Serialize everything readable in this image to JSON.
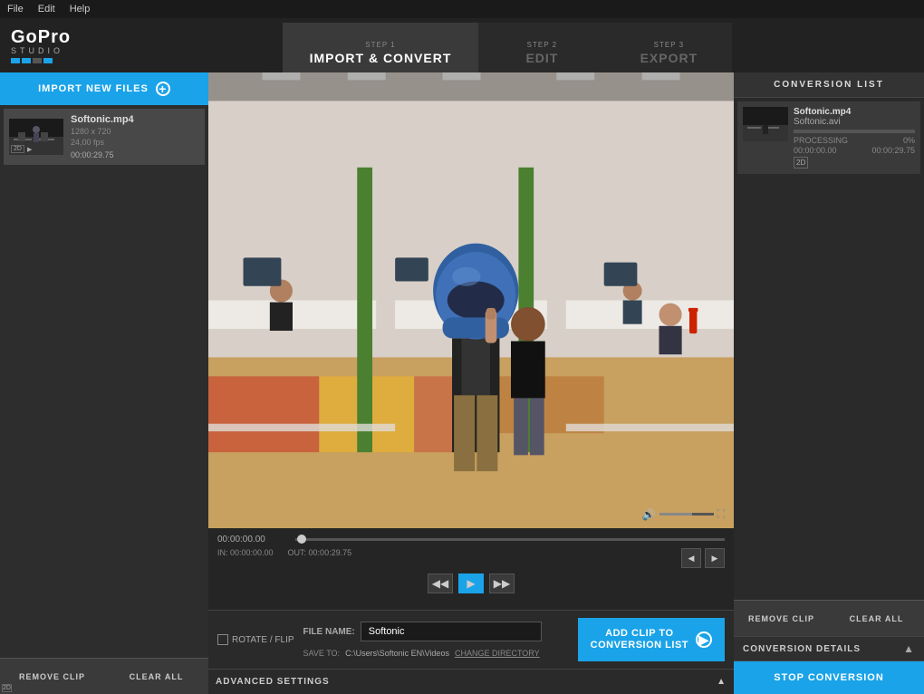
{
  "menu": {
    "items": [
      "File",
      "Edit",
      "Help"
    ]
  },
  "logo": {
    "name": "GoPro",
    "studio": "STUDIO",
    "dots": [
      "#1aa3e8",
      "#1aa3e8",
      "#555",
      "#1aa3e8"
    ]
  },
  "steps": [
    {
      "id": "step1",
      "label": "STEP 1",
      "name": "IMPORT & CONVERT",
      "active": true
    },
    {
      "id": "step2",
      "label": "STEP 2",
      "name": "EDIT",
      "active": false
    },
    {
      "id": "step3",
      "label": "STEP 3",
      "name": "EXPORT",
      "active": false
    }
  ],
  "import_button": {
    "label": "IMPORT NEW FILES"
  },
  "file_list": [
    {
      "name": "Softonic.mp4",
      "resolution": "1280 x 720",
      "fps": "24,00 fps",
      "duration": "00:00:29.75",
      "badge": "2D",
      "selected": true
    }
  ],
  "left_bottom_buttons": {
    "remove": "REMOVE CLIP",
    "clear": "CLEAR ALL"
  },
  "video_controls": {
    "timestamp": "00:00:00.00",
    "in_point": "IN: 00:00:00.00",
    "out_point": "OUT: 00:00:29.75"
  },
  "bottom_controls": {
    "rotate_label": "ROTATE / FLIP",
    "filename_label": "FILE NAME:",
    "filename_value": "Softonic",
    "saveto_label": "SAVE TO:",
    "saveto_path": "C:\\Users\\Softonic EN\\Videos",
    "change_dir_label": "CHANGE DIRECTORY",
    "add_button": "ADD CLIP TO\nCONVERSION LIST",
    "advanced_settings": "ADVANCED SETTINGS"
  },
  "right_panel": {
    "header": "CONVERSION LIST",
    "items": [
      {
        "filename_in": "Softonic.mp4",
        "filename_out": "Softonic.avi",
        "processing_label": "PROCESSING",
        "processing_pct": "0%",
        "time_start": "00:00:00.00",
        "time_end": "00:00:29.75",
        "badge": "2D",
        "progress": 0
      }
    ],
    "remove_button": "REMOVE CLIP",
    "clear_button": "CLEAR ALL",
    "details_label": "CONVERSION DETAILS",
    "stop_button": "STOP CONVERSION"
  }
}
